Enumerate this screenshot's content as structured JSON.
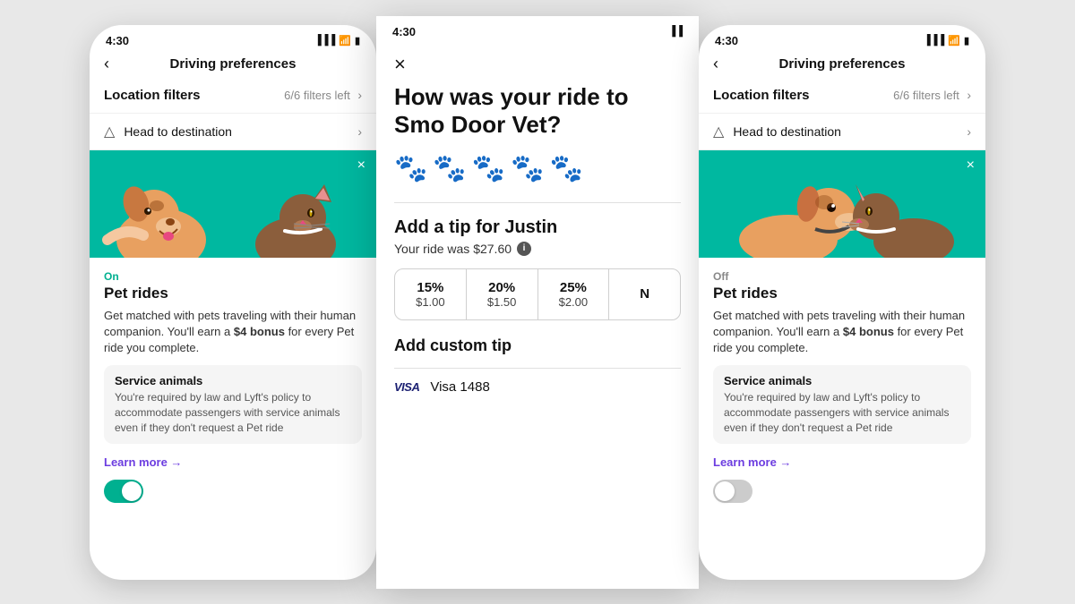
{
  "left_phone": {
    "status_time": "4:30",
    "nav_title": "Driving preferences",
    "location_filters_label": "Location filters",
    "location_filters_meta": "6/6 filters left",
    "destination_label": "Head to destination",
    "pet_rides_status": "On",
    "pet_rides_title": "Pet rides",
    "pet_rides_desc_prefix": "Get matched with pets traveling with their human companion. You'll earn a ",
    "pet_rides_bonus": "$4 bonus",
    "pet_rides_desc_suffix": " for every Pet ride you complete.",
    "service_animals_title": "Service animals",
    "service_animals_desc": "You're required by law and Lyft's policy to accommodate passengers with service animals even if they don't request a Pet ride",
    "learn_more_label": "Learn more →",
    "toggle_state": "on"
  },
  "middle_phone": {
    "status_time": "4:30",
    "close_label": "×",
    "question": "How was your ride to Smo Door Vet?",
    "paw_filled_count": 4,
    "paw_empty_count": 1,
    "tip_title": "Add a tip for Justin",
    "ride_cost_label": "Your ride was $27.60",
    "tip_options": [
      {
        "percent": "15%",
        "amount": "$1.00"
      },
      {
        "percent": "20%",
        "amount": "$1.50"
      },
      {
        "percent": "25%",
        "amount": "$2.00"
      },
      {
        "percent": "N",
        "amount": ""
      }
    ],
    "custom_tip_label": "Add custom tip",
    "visa_label": "VISA",
    "visa_number": "Visa 1488"
  },
  "right_phone": {
    "status_time": "4:30",
    "nav_title": "Driving preferences",
    "location_filters_label": "Location filters",
    "location_filters_meta": "6/6 filters left",
    "destination_label": "Head to destination",
    "pet_rides_status": "Off",
    "pet_rides_title": "Pet rides",
    "pet_rides_desc_prefix": "Get matched with pets traveling with their human companion. You'll earn a ",
    "pet_rides_bonus": "$4 bonus",
    "pet_rides_desc_suffix": " for every Pet ride you complete.",
    "service_animals_title": "Service animals",
    "service_animals_desc": "You're required by law and Lyft's policy to accommodate passengers with service animals even if they don't request a Pet ride",
    "learn_more_label": "Learn more →",
    "toggle_state": "off"
  },
  "icons": {
    "back": "‹",
    "chevron": "›",
    "destination_icon": "▲",
    "close": "×",
    "info": "i"
  }
}
